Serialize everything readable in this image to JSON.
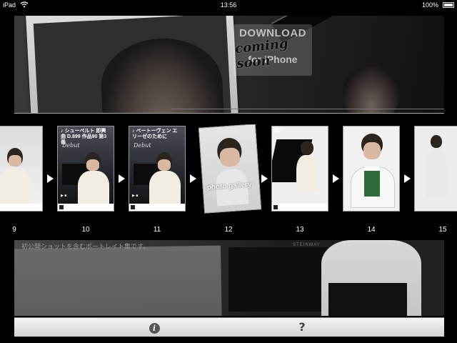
{
  "status_bar": {
    "device": "iPad",
    "time": "13:56",
    "battery": "100%"
  },
  "top_banner": {
    "download_line1": "DOWNLOAD",
    "download_line2": "for iPhone",
    "overlay": "coming soon"
  },
  "strip": {
    "arrow_icon": "play-arrow-icon",
    "numbers": [
      "9",
      "10",
      "11",
      "12",
      "13",
      "14",
      "15"
    ],
    "thumbs": [
      {
        "title": "",
        "subtitle": ""
      },
      {
        "title": "♪ シューベルト 即興曲 D.899 作品90 第3番",
        "subtitle": "Debut"
      },
      {
        "title": "♪ ベートーヴェン エリーゼのために",
        "subtitle": "Debut"
      },
      {
        "title": "",
        "subtitle": "photo gallery"
      },
      {
        "title": "",
        "subtitle": ""
      },
      {
        "title": "",
        "subtitle": ""
      },
      {
        "title": "",
        "subtitle": ""
      }
    ]
  },
  "bottom_banner": {
    "caption": "初公開ショットを含むポートレイト集です。",
    "brand": "STEINWAY"
  },
  "toolbar": {
    "info_label": "i",
    "help_label": "?"
  }
}
